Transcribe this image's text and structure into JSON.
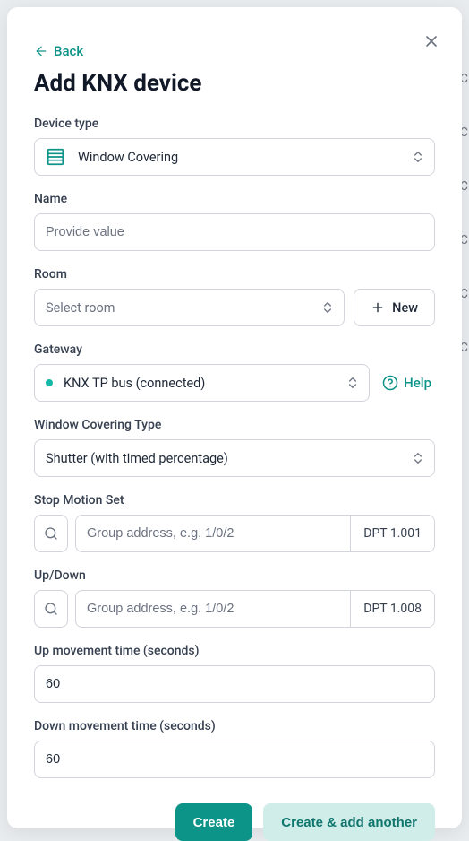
{
  "back": {
    "label": "Back"
  },
  "title": "Add KNX device",
  "labels": {
    "deviceType": "Device type",
    "name": "Name",
    "room": "Room",
    "gateway": "Gateway",
    "coveringType": "Window Covering Type",
    "stopMotion": "Stop Motion Set",
    "upDown": "Up/Down",
    "upTime": "Up movement time (seconds)",
    "downTime": "Down movement time (seconds)"
  },
  "deviceType": {
    "selected": "Window Covering"
  },
  "name": {
    "placeholder": "Provide value",
    "value": ""
  },
  "room": {
    "placeholder": "Select room",
    "newLabel": "New"
  },
  "gateway": {
    "selected": "KNX TP bus (connected)",
    "helpLabel": "Help"
  },
  "coveringType": {
    "selected": "Shutter (with timed percentage)"
  },
  "stopMotion": {
    "placeholder": "Group address, e.g. 1/0/2",
    "value": "",
    "dpt": "DPT 1.001"
  },
  "upDown": {
    "placeholder": "Group address, e.g. 1/0/2",
    "value": "",
    "dpt": "DPT 1.008"
  },
  "upTime": {
    "value": "60"
  },
  "downTime": {
    "value": "60"
  },
  "buttons": {
    "create": "Create",
    "createAnother": "Create & add another"
  },
  "bg": {
    "letter": "C"
  }
}
